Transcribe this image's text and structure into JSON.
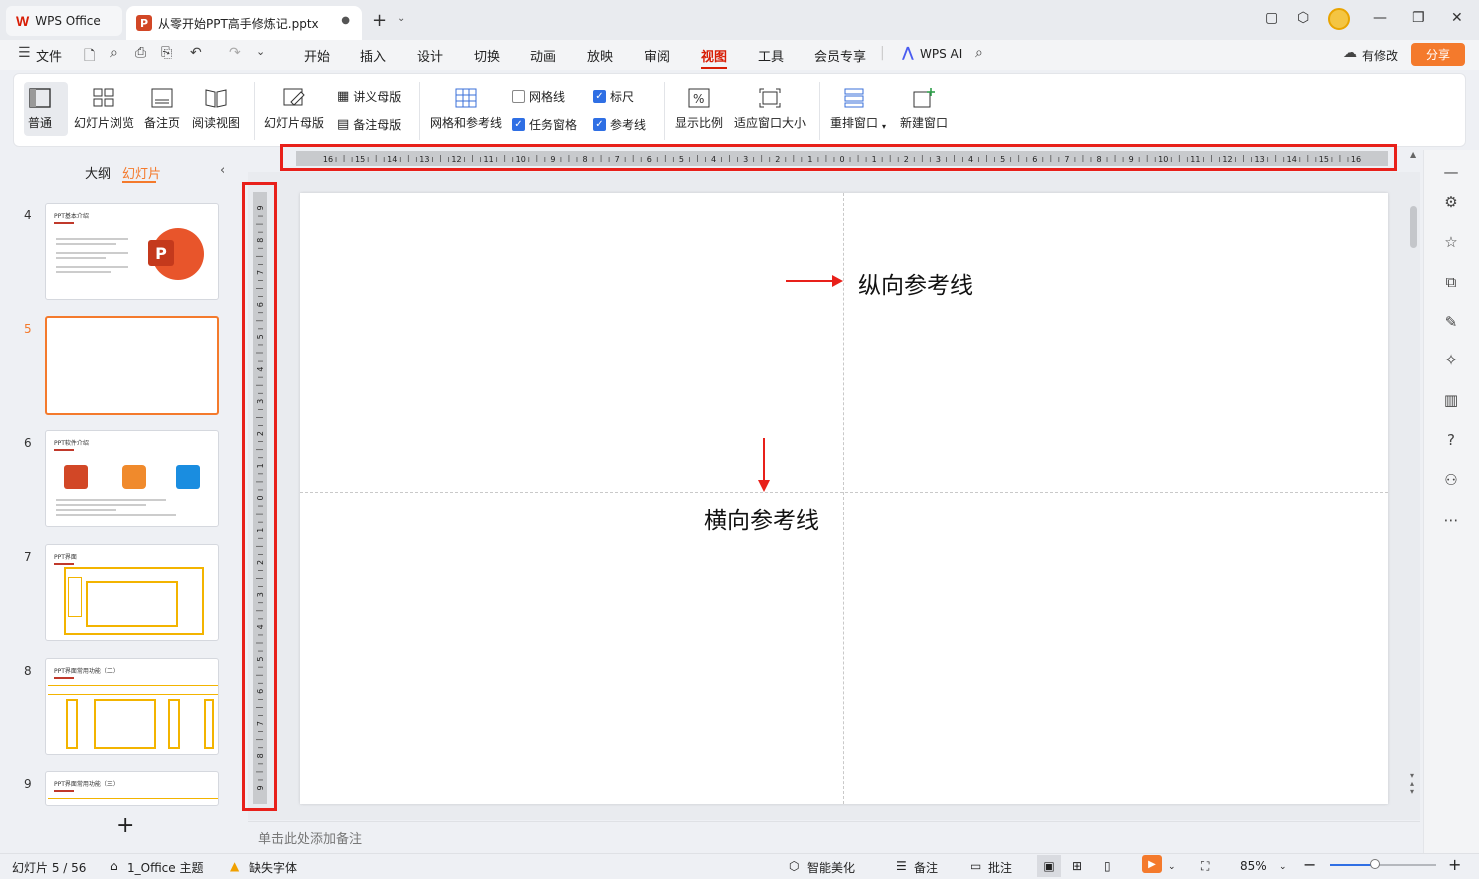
{
  "titlebar": {
    "home_tab": "WPS Office",
    "doc_tab": "从零开始PPT高手修炼记.pptx",
    "doc_close": "●",
    "add_tab": "+",
    "dropdown": "⌄",
    "minimize": "—",
    "restore": "❐",
    "close": "✕"
  },
  "menubar": {
    "file": "文件",
    "items": [
      "开始",
      "插入",
      "设计",
      "切换",
      "动画",
      "放映",
      "审阅",
      "视图",
      "工具",
      "会员专享"
    ],
    "active": "视图",
    "wps_ai": "WPS AI",
    "modified": "有修改",
    "share": "分享"
  },
  "ribbon": {
    "normal": "普通",
    "slide_browse": "幻灯片浏览",
    "notes_page": "备注页",
    "reading_view": "阅读视图",
    "slide_master": "幻灯片母版",
    "handout_master": "讲义母版",
    "notes_master": "备注母版",
    "grid_guides": "网格和参考线",
    "gridlines": {
      "label": "网格线",
      "checked": false
    },
    "task_pane": {
      "label": "任务窗格",
      "checked": true
    },
    "ruler": {
      "label": "标尺",
      "checked": true
    },
    "guides": {
      "label": "参考线",
      "checked": true
    },
    "zoom": "显示比例",
    "fit_window": "适应窗口大小",
    "arrange": "重排窗口",
    "new_window": "新建窗口"
  },
  "leftpanel": {
    "tab_outline": "大纲",
    "tab_slides": "幻灯片",
    "collapse": "‹",
    "slides": [
      {
        "num": "4",
        "title": "PPT基本介绍",
        "selected": false
      },
      {
        "num": "5",
        "title": "",
        "selected": true
      },
      {
        "num": "6",
        "title": "PPT软件介绍",
        "selected": false
      },
      {
        "num": "7",
        "title": "PPT界面",
        "selected": false
      },
      {
        "num": "8",
        "title": "PPT界面常用功能（二）",
        "selected": false
      },
      {
        "num": "9",
        "title": "PPT界面常用功能（三）",
        "selected": false
      }
    ],
    "add": "+"
  },
  "ruler": {
    "h_labels": [
      "16",
      "15",
      "14",
      "13",
      "12",
      "11",
      "10",
      "9",
      "8",
      "7",
      "6",
      "5",
      "4",
      "3",
      "2",
      "1",
      "0",
      "1",
      "2",
      "3",
      "4",
      "5",
      "6",
      "7",
      "8",
      "9",
      "10",
      "11",
      "12",
      "13",
      "14",
      "15",
      "16"
    ],
    "v_labels": [
      "9",
      "8",
      "7",
      "6",
      "5",
      "4",
      "3",
      "2",
      "1",
      "0",
      "1",
      "2",
      "3",
      "4",
      "5",
      "6",
      "7",
      "8",
      "9"
    ]
  },
  "canvas": {
    "vertical_guide_label": "纵向参考线",
    "horizontal_guide_label": "横向参考线",
    "notes_placeholder": "单击此处添加备注"
  },
  "statusbar": {
    "slide_counter": "幻灯片 5 / 56",
    "theme": "1_Office 主题",
    "missing_fonts": "缺失字体",
    "smart_beautify": "智能美化",
    "notes": "备注",
    "comments": "批注",
    "zoom": "85%",
    "zoom_level": 0.42
  },
  "colors": {
    "accent": "#f47a2c",
    "wps_red": "#d81e06",
    "highlight_box": "#e8201a",
    "check_blue": "#2f6fe4"
  }
}
